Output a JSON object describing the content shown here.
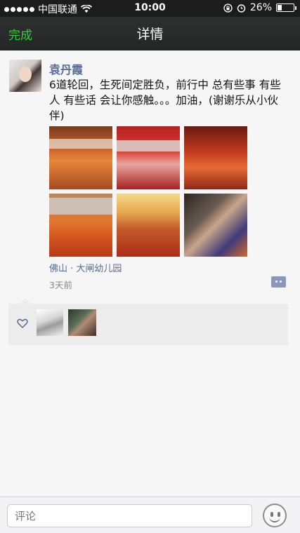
{
  "status_bar": {
    "carrier": "中国联通",
    "time": "10:00",
    "battery": "26%",
    "battery_level": 0.26,
    "icons": [
      "signal-dots-icon",
      "wifi-icon",
      "rotation-lock-icon",
      "alarm-icon",
      "battery-icon"
    ]
  },
  "nav": {
    "left_button": "完成",
    "title": "详情",
    "accent_color": "#3dc93d"
  },
  "post": {
    "author": "袁丹霞",
    "text": "6道轮回，生死间定胜负，前行中 总有些事 有些人 有些话 会让你感触。。。加油，(谢谢乐从小伙伴)",
    "photos_count": 6,
    "location": "佛山 · 大闸幼儿园",
    "time_ago": "3天前",
    "author_color": "#576b95"
  },
  "likes": {
    "icons": [
      "heart-outline-icon"
    ],
    "liker_count": 2
  },
  "bottom_bar": {
    "comment_placeholder": "评论",
    "emoji_icon": "smiley-icon"
  }
}
